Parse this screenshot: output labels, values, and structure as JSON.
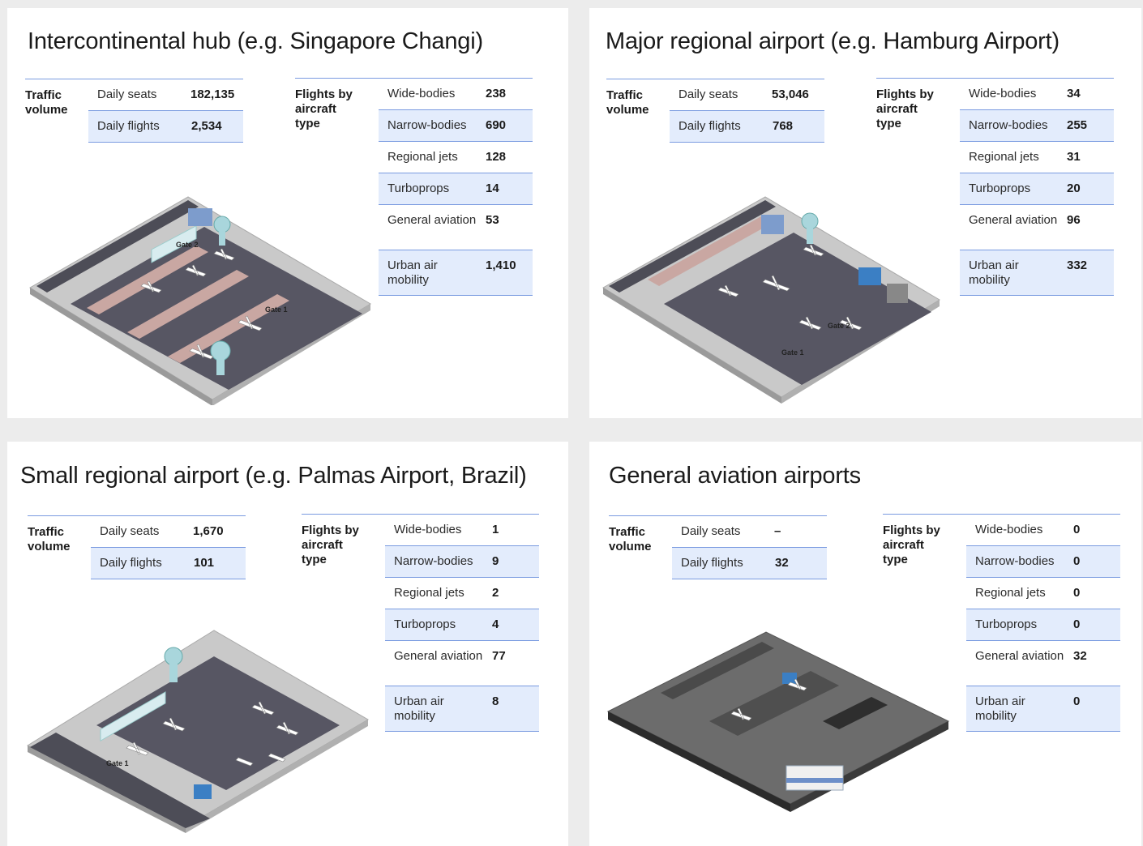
{
  "panels": [
    {
      "title": "Intercontinental hub (e.g. Singapore Changi)",
      "traffic_label": "Traffic\nvolume",
      "daily_seats_label": "Daily seats",
      "daily_seats": "182,135",
      "daily_flights_label": "Daily flights",
      "daily_flights": "2,534",
      "flights_label": "Flights by\naircraft type",
      "aircraft": [
        {
          "label": "Wide-bodies",
          "value": "238"
        },
        {
          "label": "Narrow-bodies",
          "value": "690"
        },
        {
          "label": "Regional jets",
          "value": "128"
        },
        {
          "label": "Turboprops",
          "value": "14"
        },
        {
          "label": "General aviation",
          "value": "53"
        },
        {
          "label": "Urban air mobility",
          "value": "1,410"
        }
      ],
      "gates": [
        "Gate 2",
        "Gate 1"
      ]
    },
    {
      "title": "Major regional airport (e.g. Hamburg Airport)",
      "traffic_label": "Traffic\nvolume",
      "daily_seats_label": "Daily seats",
      "daily_seats": "53,046",
      "daily_flights_label": "Daily flights",
      "daily_flights": "768",
      "flights_label": "Flights by\naircraft type",
      "aircraft": [
        {
          "label": "Wide-bodies",
          "value": "34"
        },
        {
          "label": "Narrow-bodies",
          "value": "255"
        },
        {
          "label": "Regional jets",
          "value": "31"
        },
        {
          "label": "Turboprops",
          "value": "20"
        },
        {
          "label": "General aviation",
          "value": "96"
        },
        {
          "label": "Urban air mobility",
          "value": "332"
        }
      ],
      "gates": [
        "Gate 2",
        "Gate 1"
      ]
    },
    {
      "title": "Small regional airport (e.g. Palmas Airport, Brazil)",
      "traffic_label": "Traffic\nvolume",
      "daily_seats_label": "Daily seats",
      "daily_seats": "1,670",
      "daily_flights_label": "Daily flights",
      "daily_flights": "101",
      "flights_label": "Flights by\naircraft type",
      "aircraft": [
        {
          "label": "Wide-bodies",
          "value": "1"
        },
        {
          "label": "Narrow-bodies",
          "value": "9"
        },
        {
          "label": "Regional jets",
          "value": "2"
        },
        {
          "label": "Turboprops",
          "value": "4"
        },
        {
          "label": "General aviation",
          "value": "77"
        },
        {
          "label": "Urban air mobility",
          "value": "8"
        }
      ],
      "gates": [
        "Gate 1"
      ]
    },
    {
      "title": "General aviation airports",
      "traffic_label": "Traffic\nvolume",
      "daily_seats_label": "Daily seats",
      "daily_seats": "–",
      "daily_flights_label": "Daily flights",
      "daily_flights": "32",
      "flights_label": "Flights by\naircraft type",
      "aircraft": [
        {
          "label": "Wide-bodies",
          "value": "0"
        },
        {
          "label": "Narrow-bodies",
          "value": "0"
        },
        {
          "label": "Regional jets",
          "value": "0"
        },
        {
          "label": "Turboprops",
          "value": "0"
        },
        {
          "label": "General aviation",
          "value": "32"
        },
        {
          "label": "Urban air mobility",
          "value": "0"
        }
      ],
      "gates": []
    }
  ]
}
